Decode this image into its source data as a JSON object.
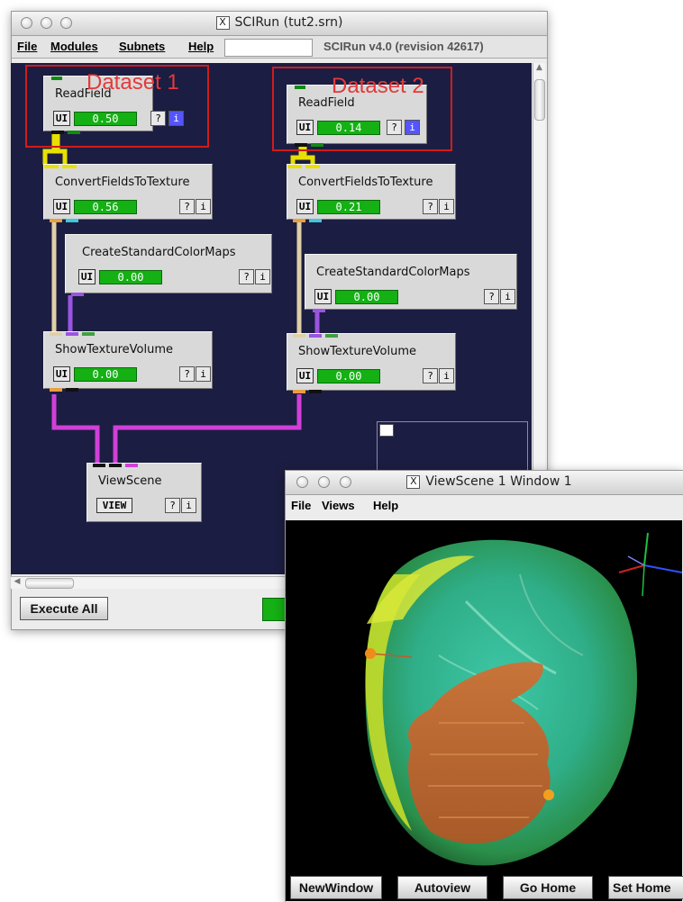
{
  "main_window": {
    "title": "SCIRun (tut2.srn)",
    "title_icon": "X",
    "menu": [
      "File",
      "Modules",
      "Subnets",
      "Help"
    ],
    "version": "SCIRun v4.0 (revision 42617)",
    "execute_label": "Execute All"
  },
  "annotations": {
    "dataset1": "Dataset 1",
    "dataset2": "Dataset 2"
  },
  "modules": {
    "readfield1": {
      "name": "ReadField",
      "ui": "UI",
      "progress": "0.50",
      "help": "?",
      "info": "i"
    },
    "readfield2": {
      "name": "ReadField",
      "ui": "UI",
      "progress": "0.14",
      "help": "?",
      "info": "i"
    },
    "convert1": {
      "name": "ConvertFieldsToTexture",
      "ui": "UI",
      "progress": "0.56",
      "help": "?",
      "info": "i"
    },
    "convert2": {
      "name": "ConvertFieldsToTexture",
      "ui": "UI",
      "progress": "0.21",
      "help": "?",
      "info": "i"
    },
    "colormap1": {
      "name": "CreateStandardColorMaps",
      "ui": "UI",
      "progress": "0.00",
      "help": "?",
      "info": "i"
    },
    "colormap2": {
      "name": "CreateStandardColorMaps",
      "ui": "UI",
      "progress": "0.00",
      "help": "?",
      "info": "i"
    },
    "texvol1": {
      "name": "ShowTextureVolume",
      "ui": "UI",
      "progress": "0.00",
      "help": "?",
      "info": "i"
    },
    "texvol2": {
      "name": "ShowTextureVolume",
      "ui": "UI",
      "progress": "0.00",
      "help": "?",
      "info": "i"
    },
    "viewscene": {
      "name": "ViewScene",
      "view": "VIEW",
      "help": "?",
      "info": "i"
    }
  },
  "viewer_window": {
    "title": "ViewScene 1 Window 1",
    "title_icon": "X",
    "menu": [
      "File",
      "Views",
      "Help"
    ],
    "buttons": [
      "NewWindow",
      "Autoview",
      "Go Home",
      "Set Home"
    ]
  },
  "colors": {
    "network_bg": "#1c1d42",
    "progress_green": "#14b014",
    "annotation_red": "#d01c1c",
    "pipe_yellow": "#e8e000",
    "pipe_tan": "#e0d0a8",
    "pipe_purple": "#9a55e0",
    "pipe_magenta": "#d040d8"
  }
}
